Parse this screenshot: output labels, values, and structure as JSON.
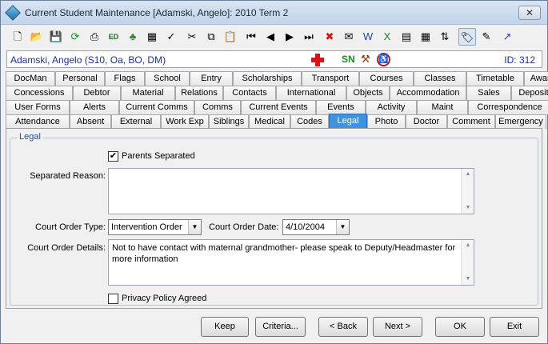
{
  "window": {
    "title": "Current Student Maintenance  [Adamski, Angelo]:  2010 Term 2",
    "close_glyph": "✕"
  },
  "toolbar": {
    "icons": [
      "new-document-icon",
      "open-folder-icon",
      "save-icon",
      "refresh-icon",
      "print-icon",
      "edit-field-icon",
      "family-tree-icon",
      "calculator-icon",
      "spell-check-icon",
      "cut-icon",
      "copy-icon",
      "paste-icon",
      "first-record-icon",
      "previous-record-icon",
      "next-record-icon",
      "last-record-icon",
      "delete-icon",
      "email-icon",
      "word-icon",
      "excel-icon",
      "report-icon",
      "calendar-icon",
      "sort-icon",
      "tag-icon",
      "add-note-icon",
      "pointer-icon"
    ]
  },
  "student": {
    "name": "Adamski, Angelo (S10, Oa, BO, DM)",
    "sn_badge": "SN",
    "id_label": "ID: 312"
  },
  "tabs": {
    "row1": [
      "DocMan",
      "Personal",
      "Flags",
      "School",
      "Entry",
      "Scholarships",
      "Transport",
      "Courses",
      "Classes",
      "Timetable",
      "Awards"
    ],
    "row2": [
      "Concessions",
      "Debtor",
      "Material",
      "Relations",
      "Contacts",
      "International",
      "Objects",
      "Accommodation",
      "Sales",
      "Deposit"
    ],
    "row3": [
      "User Forms",
      "Alerts",
      "Current Comms",
      "Comms",
      "Current Events",
      "Events",
      "Activity",
      "Maint",
      "Correspondence"
    ],
    "row4": [
      "Attendance",
      "Absent",
      "External",
      "Work Exp",
      "Siblings",
      "Medical",
      "Codes",
      "Legal",
      "Photo",
      "Doctor",
      "Comment",
      "Emergency"
    ],
    "active": "Legal"
  },
  "legal": {
    "group_title": "Legal",
    "parents_separated_label": "Parents Separated",
    "parents_separated_checked": true,
    "separated_reason_label": "Separated Reason:",
    "separated_reason_value": "",
    "court_order_type_label": "Court Order Type:",
    "court_order_type_value": "Intervention Order",
    "court_order_date_label": "Court Order Date:",
    "court_order_date_value": "4/10/2004",
    "court_order_details_label": "Court Order Details:",
    "court_order_details_value": "Not to have contact with maternal grandmother- please speak to Deputy/Headmaster for more information",
    "privacy_policy_label": "Privacy Policy Agreed",
    "privacy_policy_checked": false
  },
  "buttons": {
    "keep": "Keep",
    "criteria": "Criteria...",
    "back": "< Back",
    "next": "Next >",
    "ok": "OK",
    "exit": "Exit"
  }
}
